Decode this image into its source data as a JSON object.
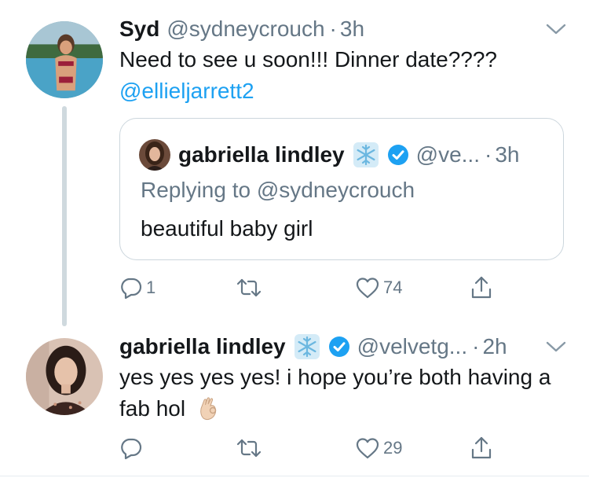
{
  "tweets": [
    {
      "author": {
        "name": "Syd",
        "handle": "@sydneycrouch"
      },
      "dot": "·",
      "time": "3h",
      "text": "Need to see u soon!!! Dinner date????",
      "mention": "@ellieljarrett2",
      "quote": {
        "author": {
          "name": "gabriella lindley",
          "handle": "@ve..."
        },
        "dot": "·",
        "time": "3h",
        "replying_to": "Replying to @sydneycrouch",
        "text": "beautiful baby girl"
      },
      "stats": {
        "replies": "1",
        "retweets": "",
        "likes": "74"
      }
    },
    {
      "author": {
        "name": "gabriella lindley",
        "handle": "@velvetg..."
      },
      "dot": "·",
      "time": "2h",
      "text": "yes yes yes yes! i hope you’re both having a fab hol",
      "emoji": "ok-hand",
      "stats": {
        "replies": "",
        "retweets": "",
        "likes": "29"
      }
    }
  ],
  "icons": {
    "caret": "chevron-down-icon",
    "snowflake": "snowflake-icon",
    "verified": "verified-badge-icon",
    "reply": "reply-icon",
    "retweet": "retweet-icon",
    "like": "heart-icon",
    "share": "share-icon"
  },
  "colors": {
    "link": "#1da1f2",
    "secondary_text": "#657786",
    "primary_text": "#14171a",
    "border": "#ccd6dd",
    "thread_line": "#cfd9de",
    "verified": "#1da1f2"
  }
}
